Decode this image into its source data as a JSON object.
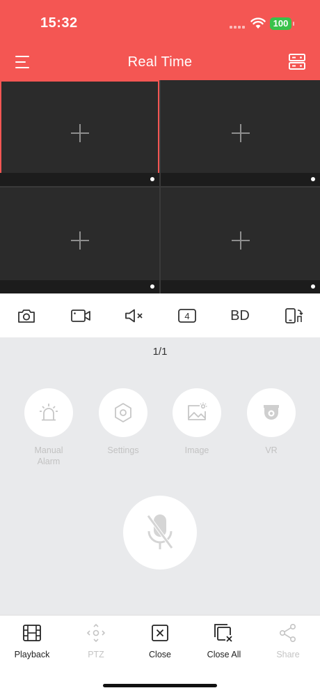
{
  "status_bar": {
    "time": "15:32",
    "battery": "100"
  },
  "header": {
    "title": "Real Time"
  },
  "grid": {
    "cells": [
      {
        "selected": true
      },
      {
        "selected": false
      },
      {
        "selected": false
      },
      {
        "selected": false
      }
    ]
  },
  "toolbar": {
    "split_count": "4",
    "quality": "BD"
  },
  "page_indicator": "1/1",
  "functions": [
    {
      "label": "Manual\nAlarm",
      "icon": "alarm-icon"
    },
    {
      "label": "Settings",
      "icon": "settings-icon"
    },
    {
      "label": "Image",
      "icon": "image-icon"
    },
    {
      "label": "VR",
      "icon": "vr-camera-icon"
    }
  ],
  "bottom_nav": [
    {
      "label": "Playback",
      "enabled": true
    },
    {
      "label": "PTZ",
      "enabled": false
    },
    {
      "label": "Close",
      "enabled": true
    },
    {
      "label": "Close All",
      "enabled": true
    },
    {
      "label": "Share",
      "enabled": false
    }
  ],
  "colors": {
    "accent": "#f45653",
    "battery": "#38c24a",
    "video_bg": "#2b2b2b"
  }
}
